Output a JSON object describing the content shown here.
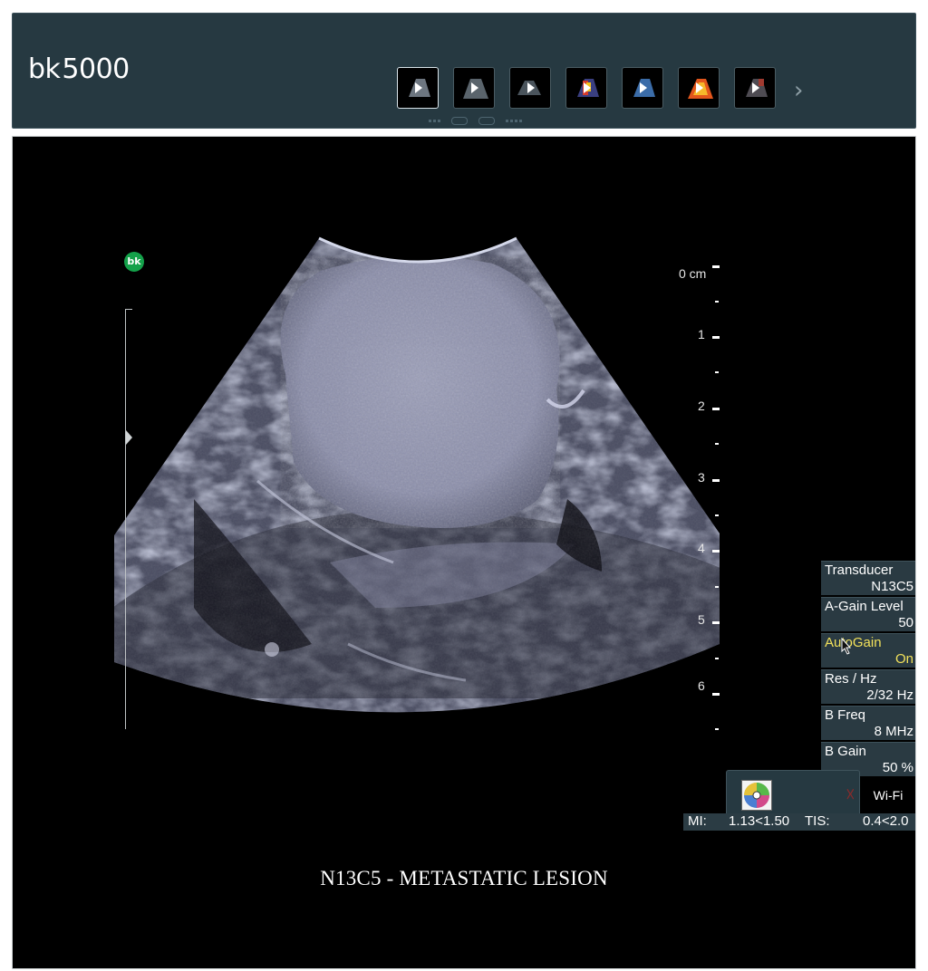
{
  "header": {
    "logo_prefix": "bk",
    "logo_model": "5000",
    "thumbnails": [
      {
        "name": "thumb-1",
        "selected": true
      },
      {
        "name": "thumb-2",
        "selected": false
      },
      {
        "name": "thumb-3",
        "selected": false
      },
      {
        "name": "thumb-4",
        "selected": false
      },
      {
        "name": "thumb-5",
        "selected": false
      },
      {
        "name": "thumb-6",
        "selected": false
      },
      {
        "name": "thumb-7",
        "selected": false
      }
    ],
    "next_icon": "chevron-right-icon"
  },
  "viewer": {
    "badge": "bk",
    "depth_unit_label": "0 cm",
    "depth_labels": [
      "1",
      "2",
      "3",
      "4",
      "5",
      "6"
    ],
    "caption": "N13C5 - METASTATIC LESION"
  },
  "params": {
    "transducer": {
      "label": "Transducer",
      "value": "N13C5"
    },
    "again": {
      "label": "A-Gain Level",
      "value": "50"
    },
    "autogain": {
      "label": "AutoGain",
      "value": "On"
    },
    "res": {
      "label": "Res / Hz",
      "value": "2/32 Hz"
    },
    "bfreq": {
      "label": "B Freq",
      "value": "8 MHz"
    },
    "bgain": {
      "label": "B Gain",
      "value": "50 %"
    }
  },
  "status": {
    "wifi": "Wi-Fi",
    "mi_label": "MI:",
    "mi_value": "1.13<1.50",
    "tis_label": "TIS:",
    "tis_value": "0.4<2.0"
  },
  "colors": {
    "header_bg": "#263941",
    "autogain_highlight": "#f2e15b",
    "badge_green": "#14a14a"
  }
}
